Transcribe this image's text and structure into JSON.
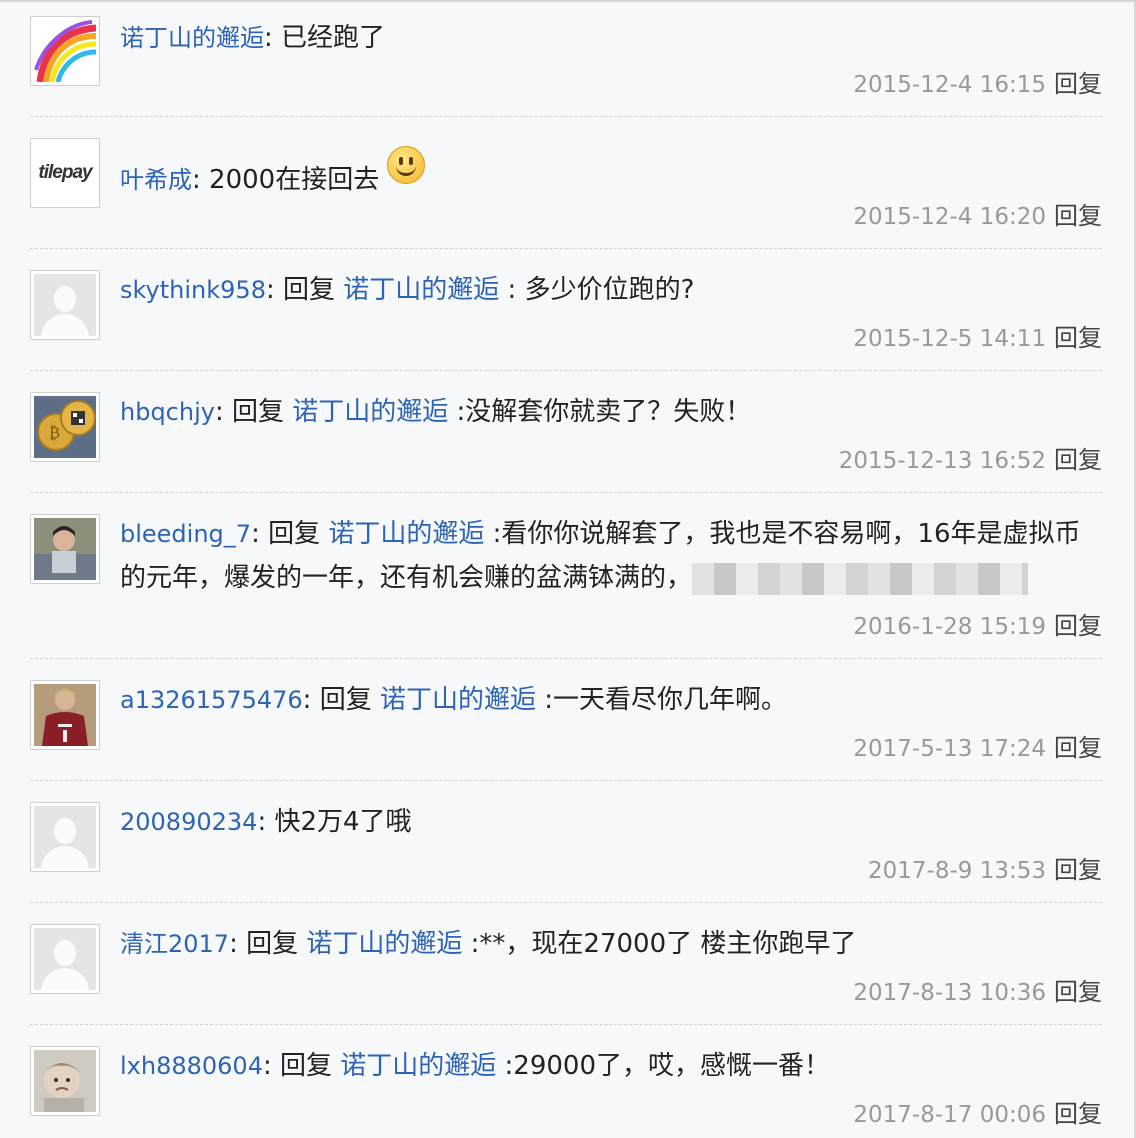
{
  "comments": [
    {
      "user": "诺丁山的邂逅",
      "reply_prefix": "",
      "quoted": "",
      "text": ": 已经跑了",
      "time": "2015-12-4 16:15",
      "reply": "回复",
      "avatar": "rainbow-swirl"
    },
    {
      "user": "叶希成",
      "reply_prefix": "",
      "quoted": "",
      "text": ": 2000在接回去",
      "time": "2015-12-4 16:20",
      "reply": "回复",
      "avatar": "tilepay-logo",
      "avatar_text": "tilepay"
    },
    {
      "user": "skythink958",
      "reply_prefix": ": 回复 ",
      "quoted": "诺丁山的邂逅",
      "text": " : 多少价位跑的?",
      "time": "2015-12-5 14:11",
      "reply": "回复",
      "avatar": "default-user"
    },
    {
      "user": "hbqchjy",
      "reply_prefix": ": 回复 ",
      "quoted": "诺丁山的邂逅",
      "text": " :没解套你就卖了？失败！",
      "time": "2015-12-13 16:52",
      "reply": "回复",
      "avatar": "bitcoin-coins"
    },
    {
      "user": "bleeding_7",
      "reply_prefix": ": 回复 ",
      "quoted": "诺丁山的邂逅",
      "text": " :看你你说解套了，我也是不容易啊，16年是虚拟币的元年，爆发的一年，还有机会赚的盆满钵满的，",
      "time": "2016-1-28 15:19",
      "reply": "回复",
      "avatar": "photo-child"
    },
    {
      "user": "a13261575476",
      "reply_prefix": ": 回复 ",
      "quoted": "诺丁山的邂逅",
      "text": " :一天看尽你几年啊。",
      "time": "2017-5-13 17:24",
      "reply": "回复",
      "avatar": "photo-jersey"
    },
    {
      "user": "200890234",
      "reply_prefix": "",
      "quoted": "",
      "text": ": 快2万4了哦",
      "time": "2017-8-9 13:53",
      "reply": "回复",
      "avatar": "default-user"
    },
    {
      "user": "清江2017",
      "reply_prefix": ": 回复 ",
      "quoted": "诺丁山的邂逅",
      "text": " :**，现在27000了 楼主你跑早了",
      "time": "2017-8-13 10:36",
      "reply": "回复",
      "avatar": "default-user"
    },
    {
      "user": "lxh8880604",
      "reply_prefix": ": 回复 ",
      "quoted": "诺丁山的邂逅",
      "text": " :29000了，哎，感慨一番！",
      "time": "2017-8-17 00:06",
      "reply": "回复",
      "avatar": "photo-baby"
    }
  ],
  "colors": {
    "username": "#2d64b3",
    "meta": "#999999",
    "background": "#f7f8fa"
  }
}
